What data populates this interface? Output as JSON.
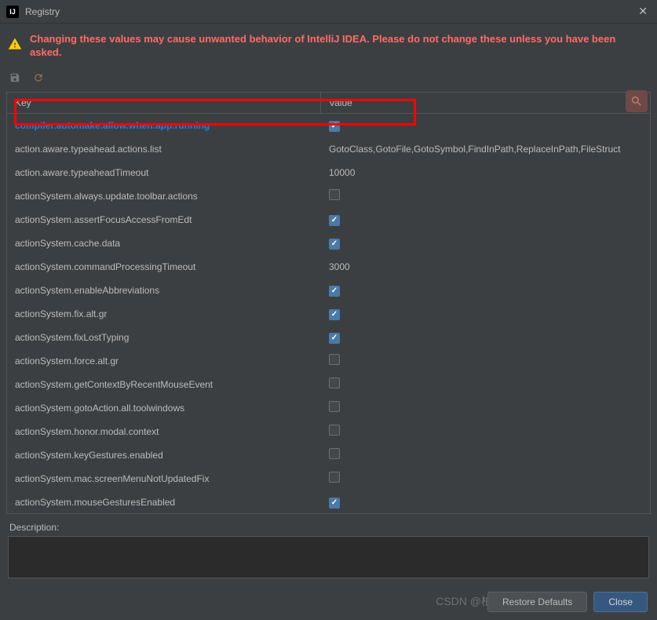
{
  "window": {
    "title": "Registry"
  },
  "warning": "Changing these values may cause unwanted behavior of IntelliJ IDEA. Please do not change these unless you have been asked.",
  "columns": {
    "key": "Key",
    "value": "Value"
  },
  "rows": [
    {
      "key": "compiler.automake.allow.when.app.running",
      "type": "check",
      "checked": true,
      "highlighted": true
    },
    {
      "key": "action.aware.typeahead.actions.list",
      "type": "text",
      "value": "GotoClass,GotoFile,GotoSymbol,FindInPath,ReplaceInPath,FileStruct"
    },
    {
      "key": "action.aware.typeaheadTimeout",
      "type": "text",
      "value": "10000"
    },
    {
      "key": "actionSystem.always.update.toolbar.actions",
      "type": "check",
      "checked": false
    },
    {
      "key": "actionSystem.assertFocusAccessFromEdt",
      "type": "check",
      "checked": true
    },
    {
      "key": "actionSystem.cache.data",
      "type": "check",
      "checked": true
    },
    {
      "key": "actionSystem.commandProcessingTimeout",
      "type": "text",
      "value": "3000"
    },
    {
      "key": "actionSystem.enableAbbreviations",
      "type": "check",
      "checked": true
    },
    {
      "key": "actionSystem.fix.alt.gr",
      "type": "check",
      "checked": true
    },
    {
      "key": "actionSystem.fixLostTyping",
      "type": "check",
      "checked": true
    },
    {
      "key": "actionSystem.force.alt.gr",
      "type": "check",
      "checked": false
    },
    {
      "key": "actionSystem.getContextByRecentMouseEvent",
      "type": "check",
      "checked": false
    },
    {
      "key": "actionSystem.gotoAction.all.toolwindows",
      "type": "check",
      "checked": false
    },
    {
      "key": "actionSystem.honor.modal.context",
      "type": "check",
      "checked": false
    },
    {
      "key": "actionSystem.keyGestures.enabled",
      "type": "check",
      "checked": false
    },
    {
      "key": "actionSystem.mac.screenMenuNotUpdatedFix",
      "type": "check",
      "checked": false
    },
    {
      "key": "actionSystem.mouseGesturesEnabled",
      "type": "check",
      "checked": true
    }
  ],
  "description_label": "Description:",
  "buttons": {
    "restore": "Restore Defaults",
    "close": "Close"
  },
  "watermark": "CSDN @柏拉是个兔子"
}
